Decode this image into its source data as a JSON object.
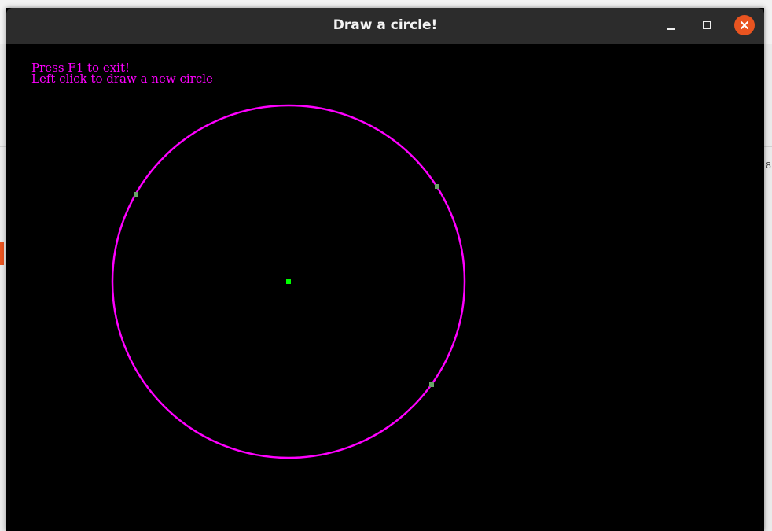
{
  "window": {
    "title": "Draw a circle!",
    "controls": {
      "minimize": "minimize-icon",
      "maximize": "maximize-icon",
      "close": "close-icon"
    }
  },
  "instructions": {
    "line1": "Press F1 to exit!",
    "line2": "Left click to draw a new circle"
  },
  "background_glyphs": {
    "right_digit": "8"
  },
  "colors": {
    "circle": "#ff00ff",
    "center_point": "#00ff00",
    "edge_points": "#6aa36a",
    "canvas_background": "#000000",
    "titlebar": "#2c2c2c",
    "close_button": "#e95420"
  }
}
